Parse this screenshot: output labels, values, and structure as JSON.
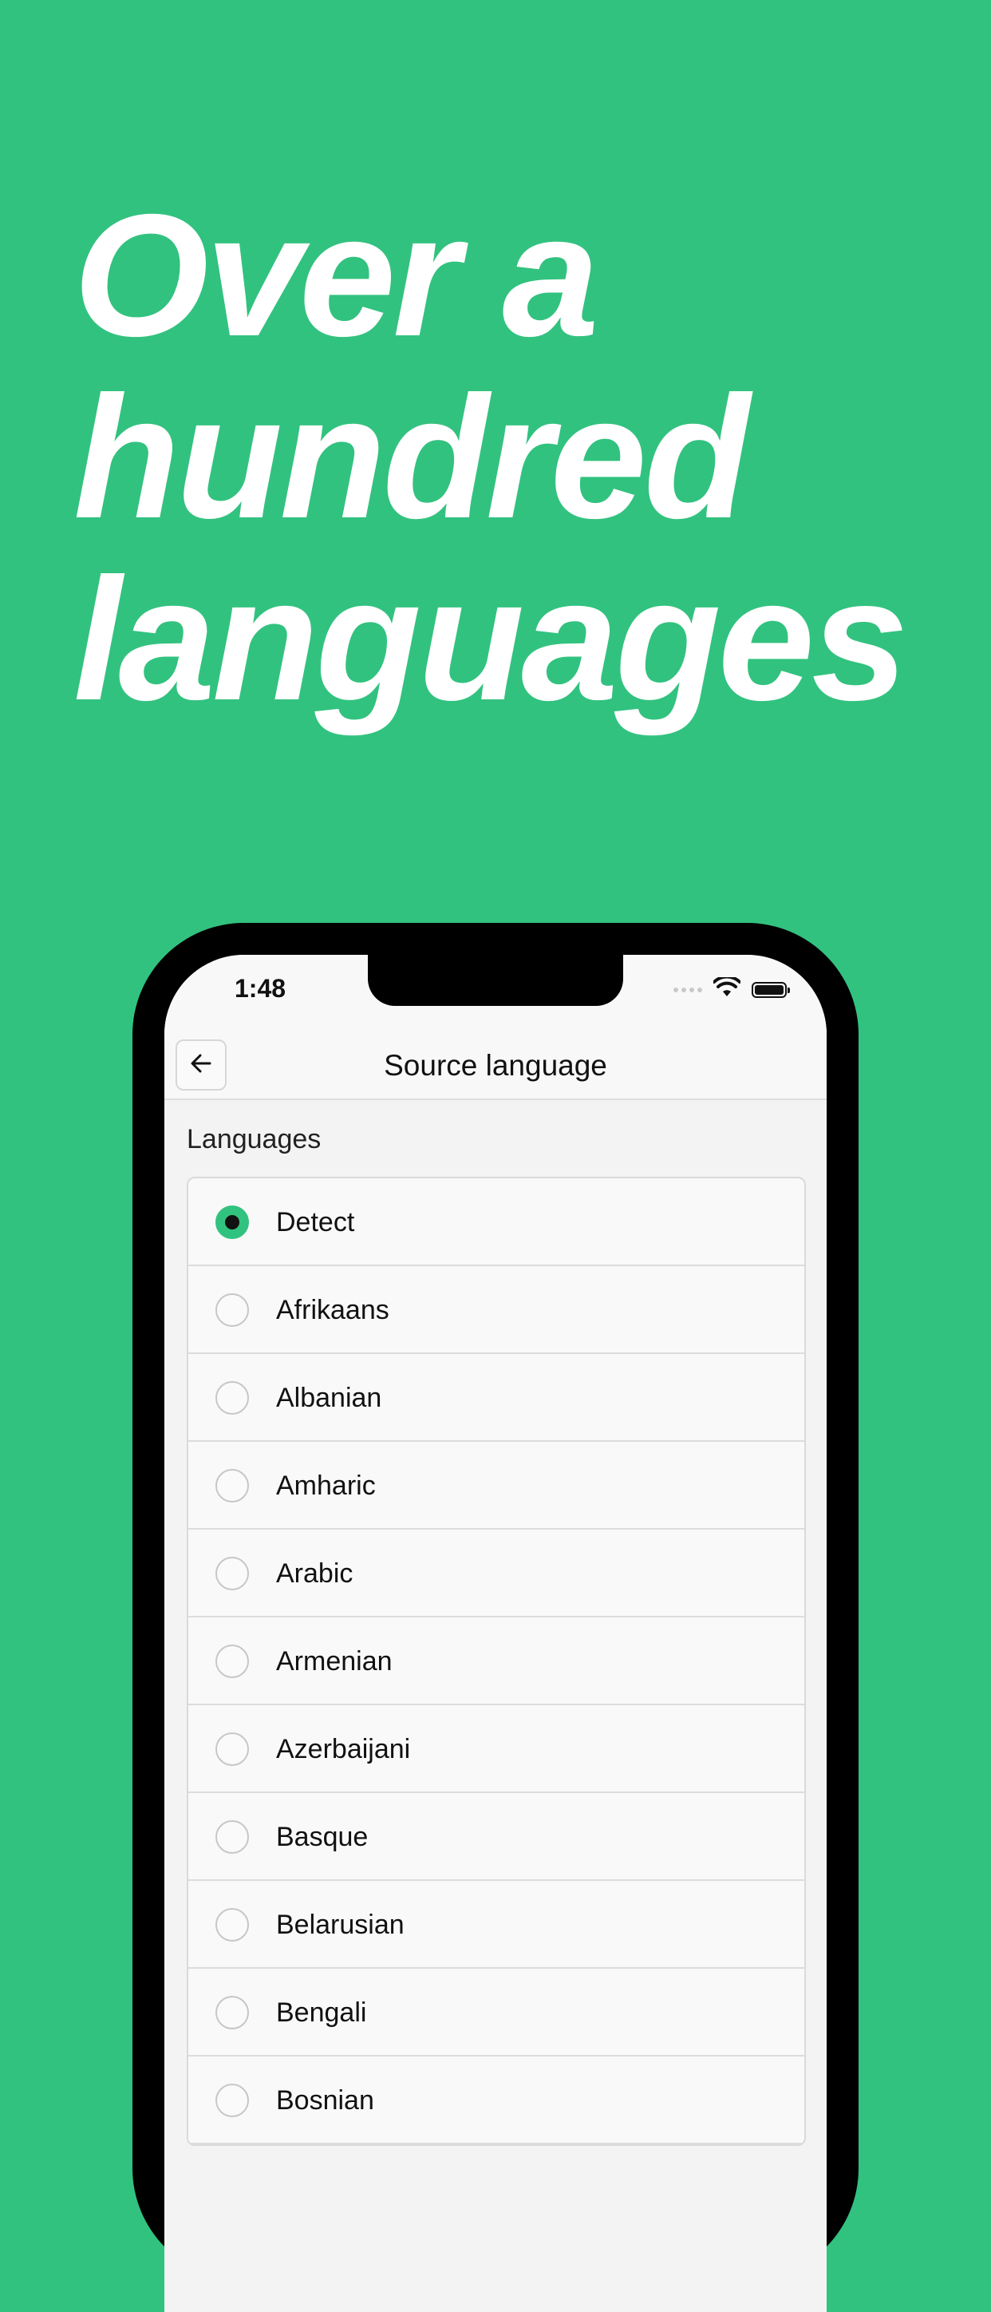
{
  "headline": [
    "Over a",
    "hundred",
    "languages"
  ],
  "status_bar": {
    "time": "1:48"
  },
  "app_bar": {
    "title": "Source language",
    "back_icon": "arrow-left-icon"
  },
  "languages_section": {
    "label": "Languages",
    "selected": "Detect",
    "items": [
      {
        "label": "Detect",
        "selected": true
      },
      {
        "label": "Afrikaans",
        "selected": false
      },
      {
        "label": "Albanian",
        "selected": false
      },
      {
        "label": "Amharic",
        "selected": false
      },
      {
        "label": "Arabic",
        "selected": false
      },
      {
        "label": "Armenian",
        "selected": false
      },
      {
        "label": "Azerbaijani",
        "selected": false
      },
      {
        "label": "Basque",
        "selected": false
      },
      {
        "label": "Belarusian",
        "selected": false
      },
      {
        "label": "Bengali",
        "selected": false
      },
      {
        "label": "Bosnian",
        "selected": false
      }
    ]
  },
  "colors": {
    "accent": "#32c27f",
    "background": "#32c27f",
    "headline_text": "#ffffff"
  }
}
